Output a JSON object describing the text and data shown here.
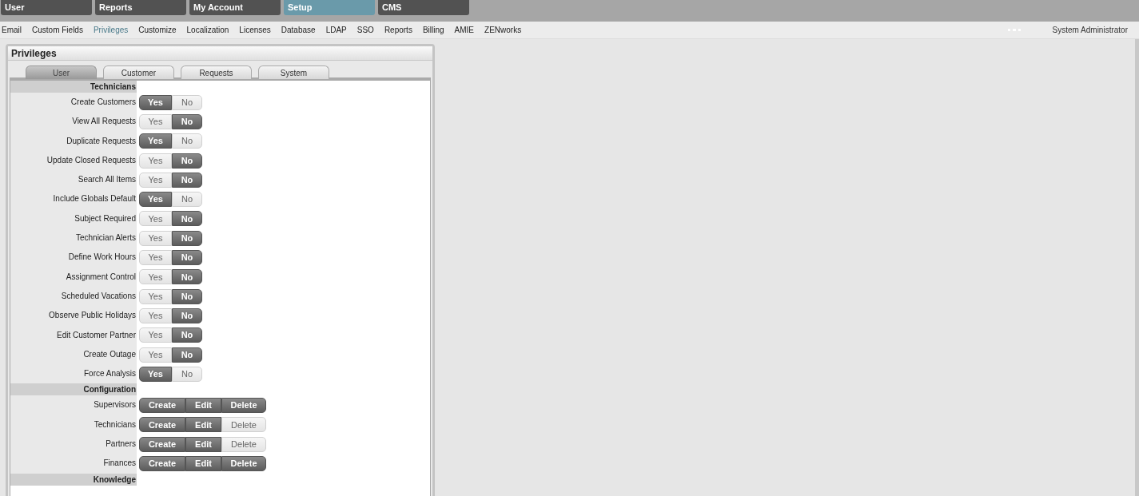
{
  "top_tabs": [
    {
      "label": "User",
      "selected": false
    },
    {
      "label": "Reports",
      "selected": false
    },
    {
      "label": "My Account",
      "selected": false
    },
    {
      "label": "Setup",
      "selected": true
    },
    {
      "label": "CMS",
      "selected": false
    }
  ],
  "sub_nav": [
    {
      "label": "Email",
      "selected": false
    },
    {
      "label": "Custom Fields",
      "selected": false
    },
    {
      "label": "Privileges",
      "selected": true
    },
    {
      "label": "Customize",
      "selected": false
    },
    {
      "label": "Localization",
      "selected": false
    },
    {
      "label": "Licenses",
      "selected": false
    },
    {
      "label": "Database",
      "selected": false
    },
    {
      "label": "LDAP",
      "selected": false
    },
    {
      "label": "SSO",
      "selected": false
    },
    {
      "label": "Reports",
      "selected": false
    },
    {
      "label": "Billing",
      "selected": false
    },
    {
      "label": "AMIE",
      "selected": false
    },
    {
      "label": "ZENworks",
      "selected": false
    }
  ],
  "user_name": "System Administrator",
  "panel": {
    "title": "Privileges",
    "tabs": [
      {
        "label": "User",
        "selected": true
      },
      {
        "label": "Customer",
        "selected": false
      },
      {
        "label": "Requests",
        "selected": false
      },
      {
        "label": "System",
        "selected": false
      }
    ],
    "sections": [
      {
        "title": "Technicians",
        "rows": [
          {
            "label": "Create Customers",
            "kind": "toggle",
            "options": [
              {
                "label": "Yes",
                "selected": true
              },
              {
                "label": "No",
                "selected": false
              }
            ]
          },
          {
            "label": "View All Requests",
            "kind": "toggle",
            "options": [
              {
                "label": "Yes",
                "selected": false
              },
              {
                "label": "No",
                "selected": true
              }
            ]
          },
          {
            "label": "Duplicate Requests",
            "kind": "toggle",
            "options": [
              {
                "label": "Yes",
                "selected": true
              },
              {
                "label": "No",
                "selected": false
              }
            ]
          },
          {
            "label": "Update Closed Requests",
            "kind": "toggle",
            "options": [
              {
                "label": "Yes",
                "selected": false
              },
              {
                "label": "No",
                "selected": true
              }
            ]
          },
          {
            "label": "Search All Items",
            "kind": "toggle",
            "options": [
              {
                "label": "Yes",
                "selected": false
              },
              {
                "label": "No",
                "selected": true
              }
            ]
          },
          {
            "label": "Include Globals Default",
            "kind": "toggle",
            "options": [
              {
                "label": "Yes",
                "selected": true
              },
              {
                "label": "No",
                "selected": false
              }
            ]
          },
          {
            "label": "Subject Required",
            "kind": "toggle",
            "options": [
              {
                "label": "Yes",
                "selected": false
              },
              {
                "label": "No",
                "selected": true
              }
            ]
          },
          {
            "label": "Technician Alerts",
            "kind": "toggle",
            "options": [
              {
                "label": "Yes",
                "selected": false
              },
              {
                "label": "No",
                "selected": true
              }
            ]
          },
          {
            "label": "Define Work Hours",
            "kind": "toggle",
            "options": [
              {
                "label": "Yes",
                "selected": false
              },
              {
                "label": "No",
                "selected": true
              }
            ]
          },
          {
            "label": "Assignment Control",
            "kind": "toggle",
            "options": [
              {
                "label": "Yes",
                "selected": false
              },
              {
                "label": "No",
                "selected": true
              }
            ]
          },
          {
            "label": "Scheduled Vacations",
            "kind": "toggle",
            "options": [
              {
                "label": "Yes",
                "selected": false
              },
              {
                "label": "No",
                "selected": true
              }
            ]
          },
          {
            "label": "Observe Public Holidays",
            "kind": "toggle",
            "options": [
              {
                "label": "Yes",
                "selected": false
              },
              {
                "label": "No",
                "selected": true
              }
            ]
          },
          {
            "label": "Edit Customer Partner",
            "kind": "toggle",
            "options": [
              {
                "label": "Yes",
                "selected": false
              },
              {
                "label": "No",
                "selected": true
              }
            ]
          },
          {
            "label": "Create Outage",
            "kind": "toggle",
            "options": [
              {
                "label": "Yes",
                "selected": false
              },
              {
                "label": "No",
                "selected": true
              }
            ]
          },
          {
            "label": "Force Analysis",
            "kind": "toggle",
            "options": [
              {
                "label": "Yes",
                "selected": true
              },
              {
                "label": "No",
                "selected": false
              }
            ]
          }
        ]
      },
      {
        "title": "Configuration",
        "rows": [
          {
            "label": "Supervisors",
            "kind": "crud",
            "options": [
              {
                "label": "Create",
                "selected": true
              },
              {
                "label": "Edit",
                "selected": true
              },
              {
                "label": "Delete",
                "selected": true
              }
            ]
          },
          {
            "label": "Technicians",
            "kind": "crud",
            "options": [
              {
                "label": "Create",
                "selected": true
              },
              {
                "label": "Edit",
                "selected": true
              },
              {
                "label": "Delete",
                "selected": false
              }
            ]
          },
          {
            "label": "Partners",
            "kind": "crud",
            "options": [
              {
                "label": "Create",
                "selected": true
              },
              {
                "label": "Edit",
                "selected": true
              },
              {
                "label": "Delete",
                "selected": false
              }
            ]
          },
          {
            "label": "Finances",
            "kind": "crud",
            "options": [
              {
                "label": "Create",
                "selected": true
              },
              {
                "label": "Edit",
                "selected": true
              },
              {
                "label": "Delete",
                "selected": true
              }
            ]
          }
        ]
      },
      {
        "title": "Knowledge"
      }
    ]
  }
}
